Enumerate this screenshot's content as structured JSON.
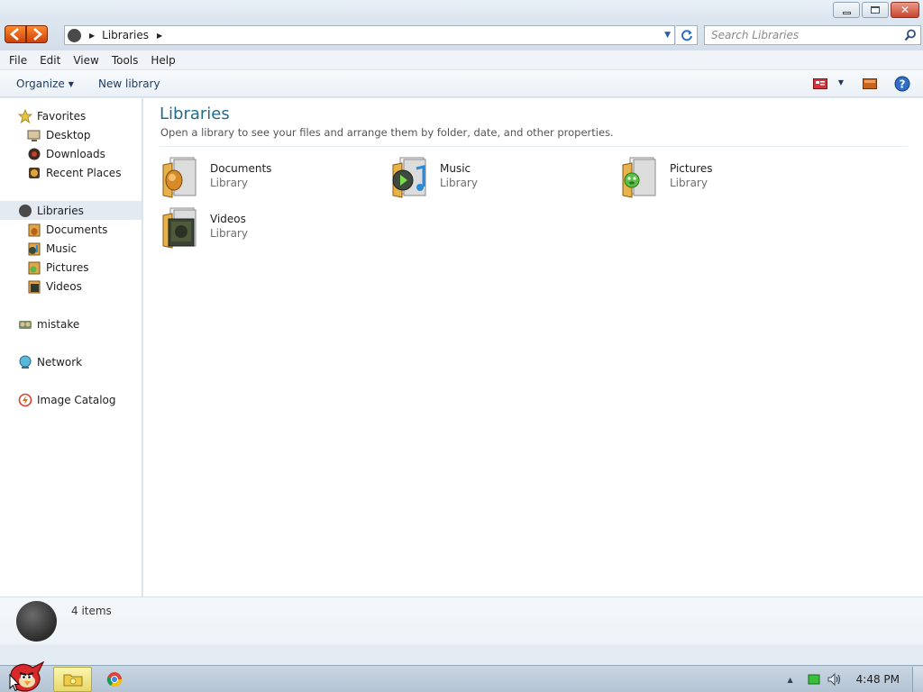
{
  "window": {
    "minimize_icon": "minimize-icon",
    "maximize_icon": "restore-icon",
    "close_icon": "close-icon"
  },
  "address": {
    "crumbs": [
      "Libraries"
    ],
    "search_placeholder": "Search Libraries"
  },
  "menu": [
    "File",
    "Edit",
    "View",
    "Tools",
    "Help"
  ],
  "toolbar": {
    "organize": "Organize",
    "new_library": "New library"
  },
  "nav": {
    "favorites": "Favorites",
    "favorites_items": [
      "Desktop",
      "Downloads",
      "Recent Places"
    ],
    "libraries": "Libraries",
    "libraries_items": [
      "Documents",
      "Music",
      "Pictures",
      "Videos"
    ],
    "homegroup": "mistake",
    "network": "Network",
    "image_catalog": "Image Catalog"
  },
  "content": {
    "title": "Libraries",
    "description": "Open a library to see your files and arrange them by folder, date, and other properties.",
    "libraries": [
      {
        "name": "Documents",
        "type": "Library"
      },
      {
        "name": "Music",
        "type": "Library"
      },
      {
        "name": "Pictures",
        "type": "Library"
      },
      {
        "name": "Videos",
        "type": "Library"
      }
    ]
  },
  "details": {
    "count": "4 items"
  },
  "taskbar": {
    "clock": "4:48 PM"
  },
  "colors": {
    "accent": "#1e6b8a",
    "nav_arrows": "#e0601a",
    "selected_bg": "#e3eaf2"
  }
}
